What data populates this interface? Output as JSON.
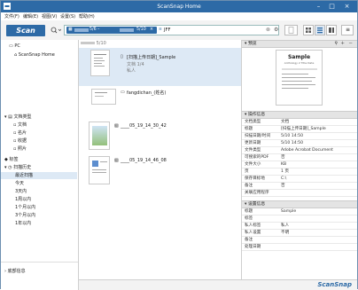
{
  "window": {
    "title": "ScanSnap Home"
  },
  "menu": [
    "文件(F)",
    "编辑(E)",
    "视图(V)",
    "设置(S)",
    "帮助(H)"
  ],
  "toolbar": {
    "scan_label": "Scan",
    "date_chip_a": "5/6",
    "date_chip_b": "5/10",
    "query_text": "JFF"
  },
  "left": {
    "top_items": [
      "PC",
      "ScanSnap Home"
    ],
    "sections": [
      {
        "label": "文档类型",
        "children": [
          "文档",
          "名片",
          "收据",
          "照片"
        ]
      },
      {
        "label": "标签"
      },
      {
        "label": "扫描历史",
        "children": [
          "最近扫描",
          "今天",
          "3天内",
          "1周以内",
          "1个月以内",
          "3个月以内",
          "1年以内"
        ]
      }
    ],
    "bottom_item": "底部信息"
  },
  "list": {
    "date_header": "5/10",
    "records": [
      {
        "title": "[扫描上传日期]_Sample",
        "sub1": "文档 1/4",
        "sub2": "私人"
      },
      {
        "title": "fangdichan_(姓名)"
      },
      {
        "title": "____05_19_14_30_42"
      },
      {
        "title": "____05_19_14_46_08"
      }
    ]
  },
  "preview": {
    "header": "预览",
    "doc_title": "Sample",
    "doc_sub": "Anthology 2 Title Date"
  },
  "details": {
    "header": "操作信息",
    "rows": [
      {
        "k": "文档类型",
        "v": "文档"
      },
      {
        "k": "标题",
        "v": "[扫描上传日期]_Sample"
      },
      {
        "k": "扫描日期/时间",
        "v": "5/10 14:50"
      },
      {
        "k": "更新日期",
        "v": "5/10 14:50"
      },
      {
        "k": "文件类型",
        "v": "Adobe Acrobat Document"
      },
      {
        "k": "可搜索的PDF",
        "v": "否"
      },
      {
        "k": "文件大小",
        "v": "KB"
      },
      {
        "k": "页",
        "v": "1 页"
      },
      {
        "k": "保存目标地",
        "v": "C:\\"
      },
      {
        "k": "备注",
        "v": "否"
      },
      {
        "k": "关联应用程序",
        "v": ""
      }
    ]
  },
  "extra": {
    "header": "设置信息",
    "rows": [
      {
        "k": "标题",
        "v": "Sample"
      },
      {
        "k": "标签",
        "v": ""
      },
      {
        "k": "私人标签",
        "v": "私人"
      },
      {
        "k": "私人设置",
        "v": "不明"
      },
      {
        "k": "备注",
        "v": ""
      },
      {
        "k": "处理日期",
        "v": ""
      }
    ]
  },
  "footer": {
    "brand": "ScanSnap"
  },
  "colors": {
    "accent": "#2d6aa6",
    "selected": "#dde9f5"
  }
}
